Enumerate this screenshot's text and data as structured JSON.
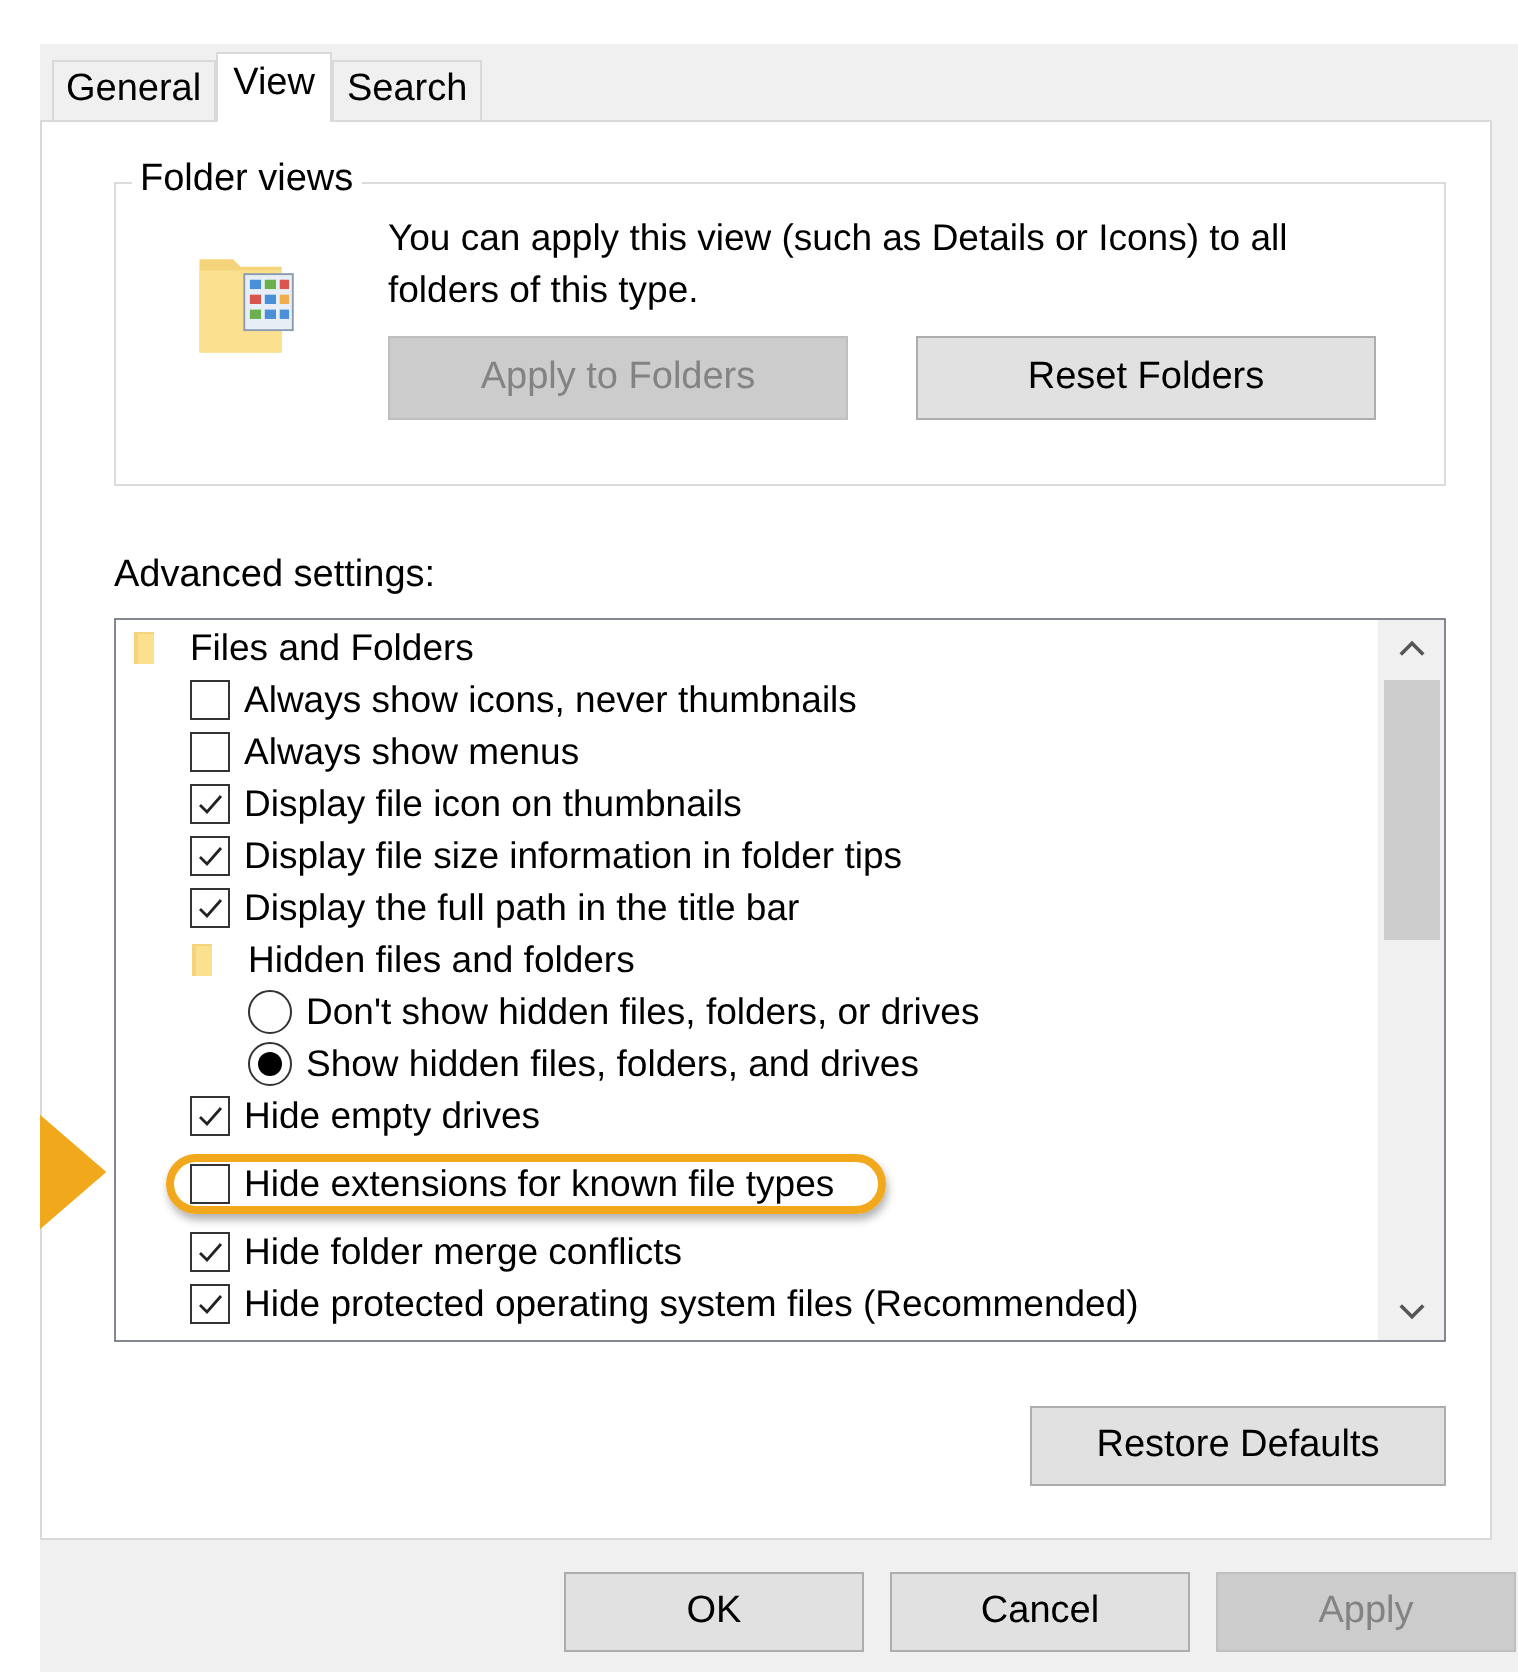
{
  "tabs": [
    {
      "label": "General",
      "selected": false
    },
    {
      "label": "View",
      "selected": true
    },
    {
      "label": "Search",
      "selected": false
    }
  ],
  "folder_views": {
    "title": "Folder views",
    "description": "You can apply this view (such as Details or Icons) to all folders of this type.",
    "buttons": [
      {
        "label": "Apply to Folders",
        "disabled": true
      },
      {
        "label": "Reset Folders",
        "disabled": false
      }
    ]
  },
  "advanced_settings": {
    "label": "Advanced settings:",
    "items": [
      {
        "kind": "group",
        "label": "Files and Folders",
        "children": [
          {
            "kind": "checkbox",
            "label": "Always show icons, never thumbnails",
            "checked": false,
            "highlighted": false
          },
          {
            "kind": "checkbox",
            "label": "Always show menus",
            "checked": false,
            "highlighted": false
          },
          {
            "kind": "checkbox",
            "label": "Display file icon on thumbnails",
            "checked": true,
            "highlighted": false
          },
          {
            "kind": "checkbox",
            "label": "Display file size information in folder tips",
            "checked": true,
            "highlighted": false
          },
          {
            "kind": "checkbox",
            "label": "Display the full path in the title bar",
            "checked": true,
            "highlighted": false
          },
          {
            "kind": "group",
            "label": "Hidden files and folders",
            "children": [
              {
                "kind": "radio",
                "label": "Don't show hidden files, folders, or drives",
                "selected": false
              },
              {
                "kind": "radio",
                "label": "Show hidden files, folders, and drives",
                "selected": true
              }
            ]
          },
          {
            "kind": "checkbox",
            "label": "Hide empty drives",
            "checked": true,
            "highlighted": false
          },
          {
            "kind": "checkbox",
            "label": "Hide extensions for known file types",
            "checked": false,
            "highlighted": true
          },
          {
            "kind": "checkbox",
            "label": "Hide folder merge conflicts",
            "checked": true,
            "highlighted": false
          },
          {
            "kind": "checkbox",
            "label": "Hide protected operating system files (Recommended)",
            "checked": true,
            "highlighted": false
          }
        ]
      }
    ]
  },
  "restore_button": {
    "label": "Restore Defaults"
  },
  "dialog_buttons": [
    {
      "label": "OK",
      "disabled": false
    },
    {
      "label": "Cancel",
      "disabled": false
    },
    {
      "label": "Apply",
      "disabled": true
    }
  ]
}
